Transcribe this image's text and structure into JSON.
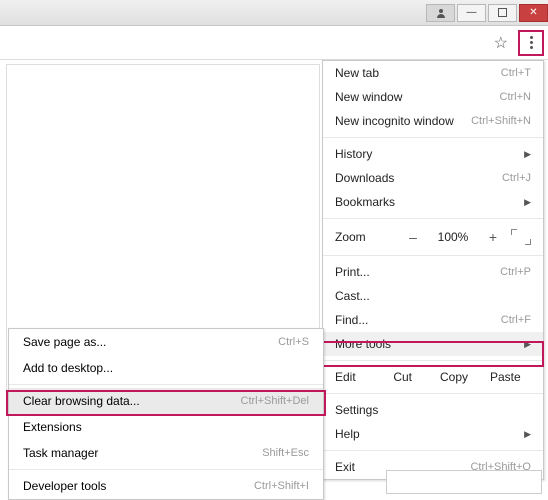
{
  "toolbar": {
    "star_icon": "star-icon",
    "kebab_icon": "menu-dots"
  },
  "menu": {
    "new_tab": {
      "label": "New tab",
      "shortcut": "Ctrl+T"
    },
    "new_window": {
      "label": "New window",
      "shortcut": "Ctrl+N"
    },
    "new_incognito": {
      "label": "New incognito window",
      "shortcut": "Ctrl+Shift+N"
    },
    "history": {
      "label": "History"
    },
    "downloads": {
      "label": "Downloads",
      "shortcut": "Ctrl+J"
    },
    "bookmarks": {
      "label": "Bookmarks"
    },
    "zoom": {
      "label": "Zoom",
      "minus": "–",
      "pct": "100%",
      "plus": "+"
    },
    "print": {
      "label": "Print...",
      "shortcut": "Ctrl+P"
    },
    "cast": {
      "label": "Cast..."
    },
    "find": {
      "label": "Find...",
      "shortcut": "Ctrl+F"
    },
    "more_tools": {
      "label": "More tools"
    },
    "edit": {
      "label": "Edit",
      "cut": "Cut",
      "copy": "Copy",
      "paste": "Paste"
    },
    "settings": {
      "label": "Settings"
    },
    "help": {
      "label": "Help"
    },
    "exit": {
      "label": "Exit",
      "shortcut": "Ctrl+Shift+Q"
    }
  },
  "submenu": {
    "save_page": {
      "label": "Save page as...",
      "shortcut": "Ctrl+S"
    },
    "add_desktop": {
      "label": "Add to desktop..."
    },
    "clear_data": {
      "label": "Clear browsing data...",
      "shortcut": "Ctrl+Shift+Del"
    },
    "extensions": {
      "label": "Extensions"
    },
    "task_manager": {
      "label": "Task manager",
      "shortcut": "Shift+Esc"
    },
    "dev_tools": {
      "label": "Developer tools",
      "shortcut": "Ctrl+Shift+I"
    }
  }
}
